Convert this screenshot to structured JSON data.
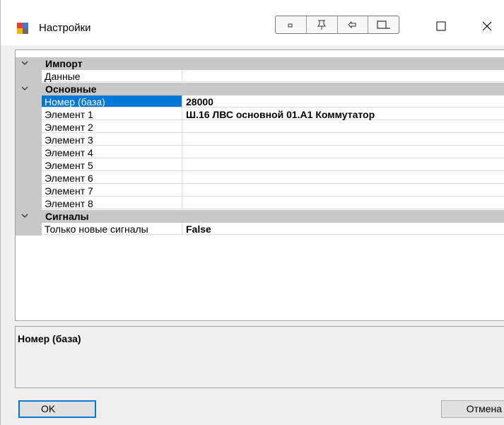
{
  "window": {
    "title": "Настройки",
    "controls": {
      "maximize_icon": "maximize-icon",
      "close_icon": "close-icon"
    },
    "title_tools": [
      "dot-icon",
      "pin-icon",
      "restore-icon",
      "dock-icon"
    ]
  },
  "property_grid": {
    "categories": [
      {
        "label": "Импорт",
        "rows": [
          {
            "name": "Данные",
            "value": ""
          }
        ]
      },
      {
        "label": "Основные",
        "rows": [
          {
            "name": "Номер (база)",
            "value": "28000"
          },
          {
            "name": "Элемент 1",
            "value": "Ш.16 ЛВС основной 01.А1 Коммутатор"
          },
          {
            "name": "Элемент 2",
            "value": ""
          },
          {
            "name": "Элемент 3",
            "value": ""
          },
          {
            "name": "Элемент 4",
            "value": ""
          },
          {
            "name": "Элемент 5",
            "value": ""
          },
          {
            "name": "Элемент 6",
            "value": ""
          },
          {
            "name": "Элемент 7",
            "value": ""
          },
          {
            "name": "Элемент 8",
            "value": ""
          }
        ]
      },
      {
        "label": "Сигналы",
        "rows": [
          {
            "name": "Только новые сигналы",
            "value": "False"
          }
        ]
      }
    ],
    "selected_row": "Номер (база)"
  },
  "help": {
    "title": "Номер (база)"
  },
  "buttons": {
    "ok": "OK",
    "cancel": "Отмена"
  },
  "colors": {
    "selection": "#0078d7",
    "category_bg": "#c8c8c8"
  }
}
